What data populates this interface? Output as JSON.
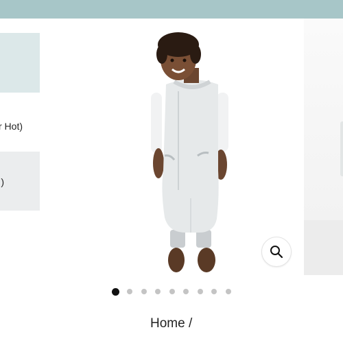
{
  "header": {
    "bar_color": "#a7c6c8"
  },
  "options": {
    "item1_label": "r Hot)",
    "item2_label": ")"
  },
  "gallery": {
    "main_image": "toddler-in-sleep-suit-photo",
    "zoom_icon": "search-icon",
    "dot_count": 9,
    "active_dot": 1
  },
  "breadcrumb": {
    "text": "Home /"
  }
}
